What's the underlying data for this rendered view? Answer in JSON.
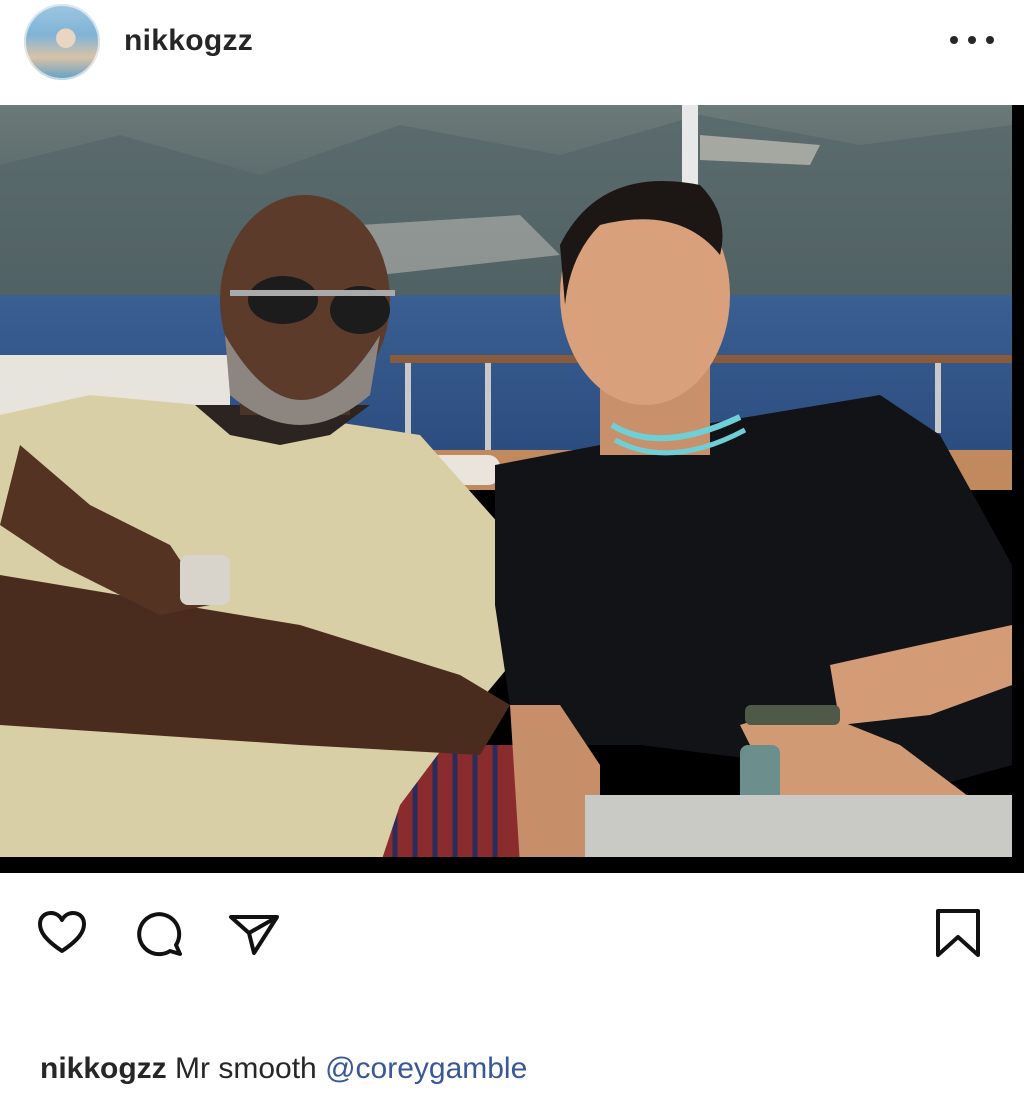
{
  "post": {
    "username": "nikkogzz",
    "more_icon": "more-horizontal-icon",
    "image_alt": "Two men sitting on a yacht deck with a coastal mountain town behind them",
    "actions": {
      "like_icon": "heart-icon",
      "comment_icon": "comment-icon",
      "share_icon": "send-icon",
      "save_icon": "bookmark-icon"
    },
    "caption": {
      "username": "nikkogzz",
      "text": "Mr smooth",
      "mention": "@coreygamble"
    }
  },
  "colors": {
    "text": "#262626",
    "mention": "#385898",
    "background": "#ffffff"
  }
}
